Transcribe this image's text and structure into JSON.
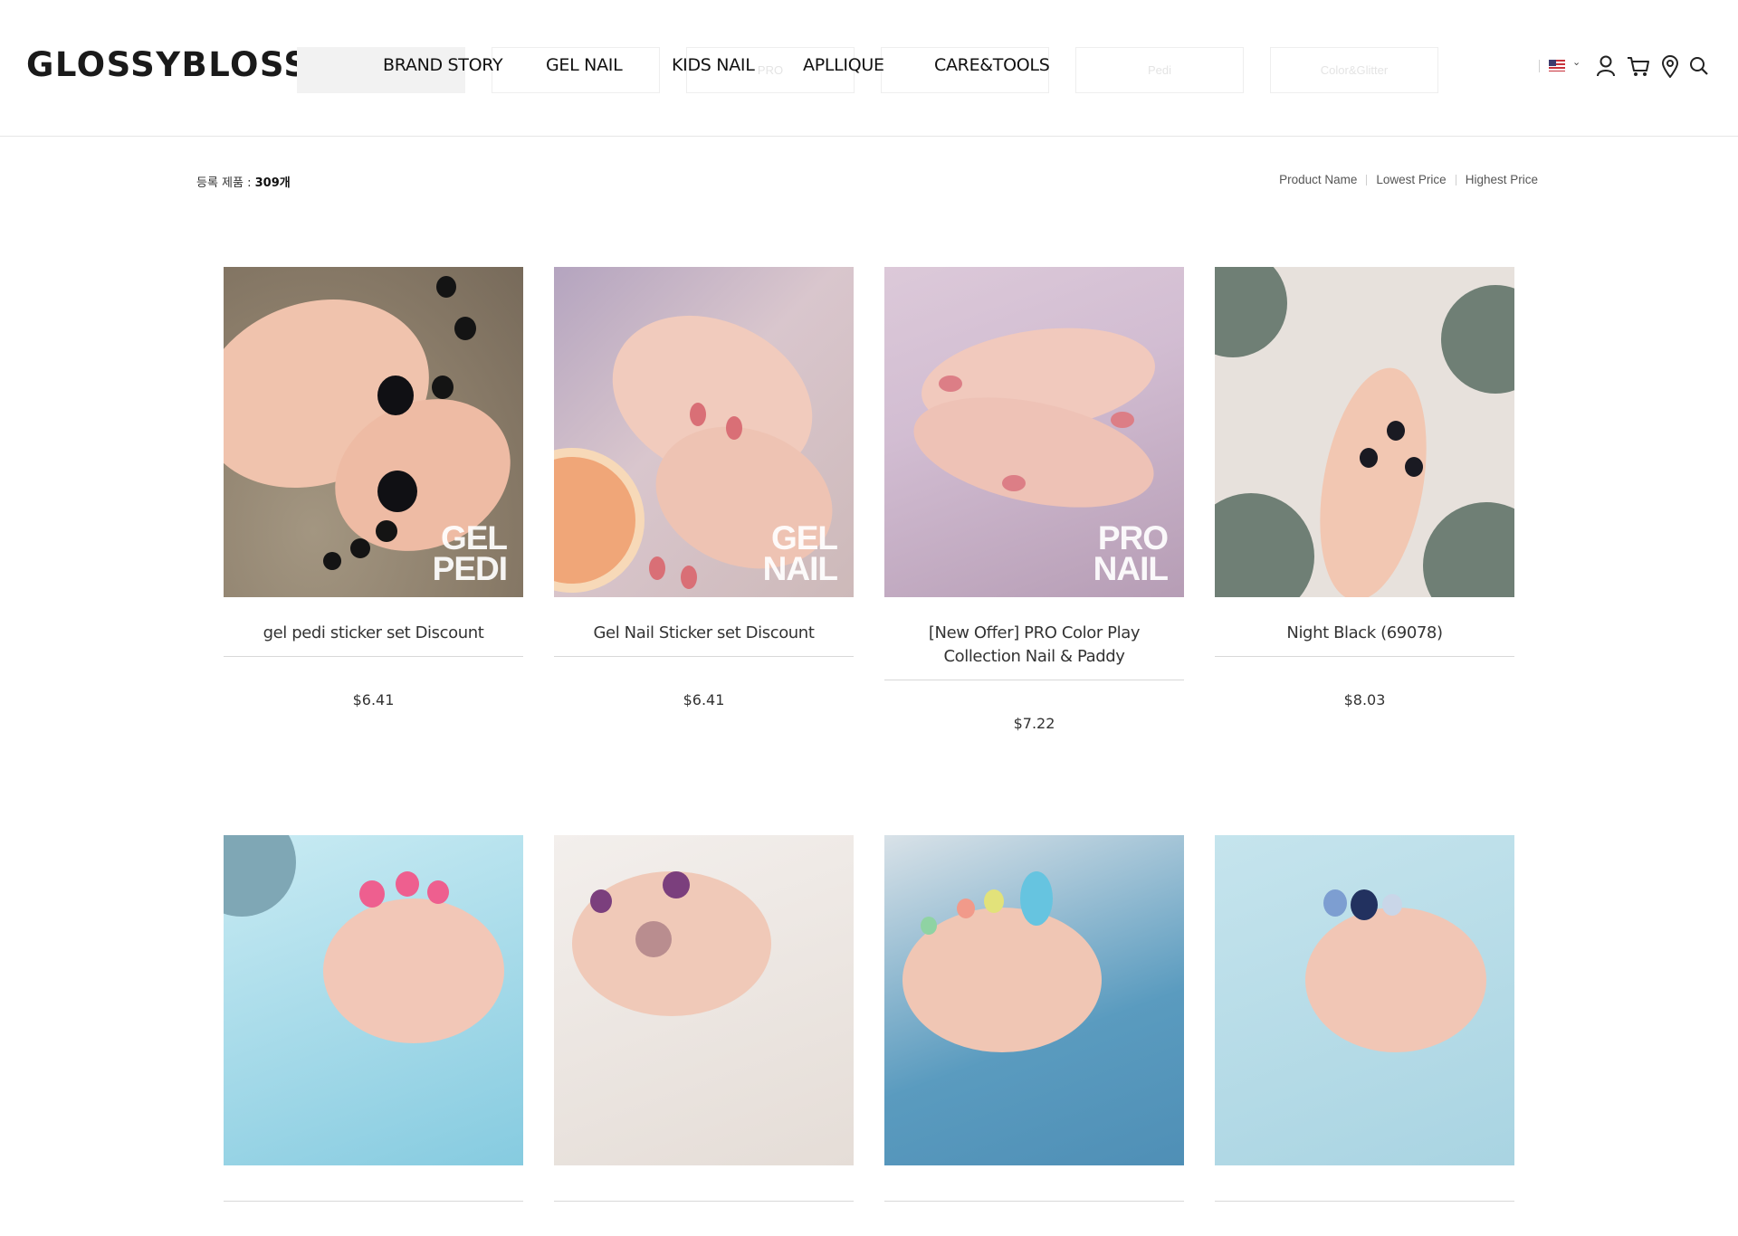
{
  "header": {
    "logo": "GLOSSYBLOSSOM",
    "nav": [
      "BRAND STORY",
      "GEL NAIL",
      "KIDS NAIL",
      "APLLIQUE",
      "CARE&TOOLS"
    ],
    "sub_tabs": [
      "",
      "",
      "PRO",
      "",
      "Pedi",
      "Color&Glitter"
    ],
    "icons": [
      "us-flag-icon",
      "user-icon",
      "cart-icon",
      "location-pin-icon",
      "search-icon"
    ]
  },
  "listing": {
    "count_label": "등록 제품 : ",
    "count_value": "309개",
    "sort_options": [
      "Product Name",
      "Lowest Price",
      "Highest Price"
    ]
  },
  "products": [
    {
      "name": "gel pedi sticker set Discount",
      "price": "$6.41",
      "badge": [
        "GEL",
        "PEDI"
      ]
    },
    {
      "name": "Gel Nail Sticker set Discount",
      "price": "$6.41",
      "badge": [
        "GEL",
        "NAIL"
      ]
    },
    {
      "name": "[New Offer] PRO Color Play Collection Nail & Paddy",
      "price": "$7.22",
      "badge": [
        "PRO",
        "NAIL"
      ]
    },
    {
      "name": "Night Black (69078)",
      "price": "$8.03",
      "badge": []
    },
    {
      "name": "",
      "price": "",
      "badge": []
    },
    {
      "name": "",
      "price": "",
      "badge": []
    },
    {
      "name": "",
      "price": "",
      "badge": []
    },
    {
      "name": "",
      "price": "",
      "badge": []
    }
  ],
  "colors": {
    "text": "#222222",
    "border": "#d8d8d8",
    "muted": "#555555"
  }
}
